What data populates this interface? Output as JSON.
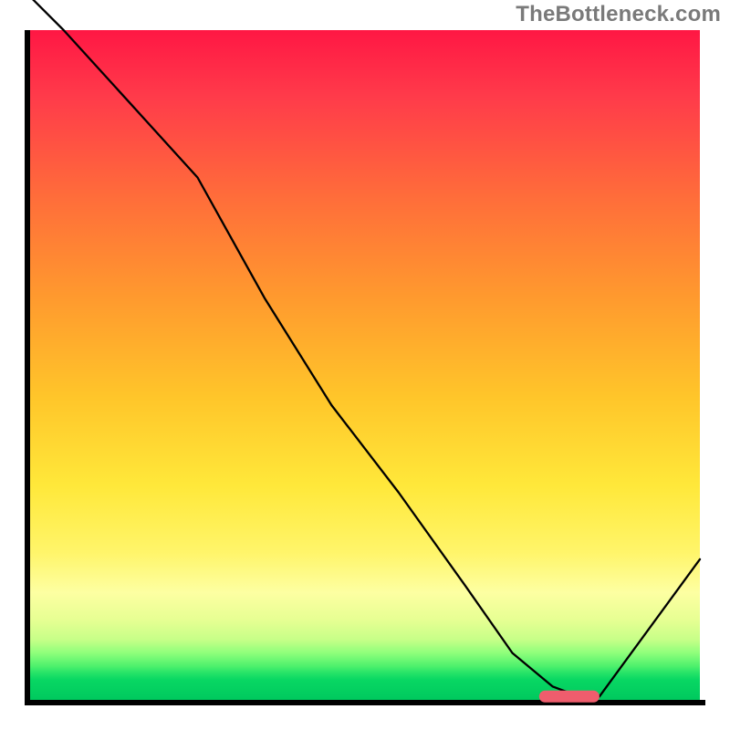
{
  "watermark": "TheBottleneck.com",
  "chart_data": {
    "type": "line",
    "title": "",
    "xlabel": "",
    "ylabel": "",
    "xlim": [
      0,
      100
    ],
    "ylim": [
      0,
      100
    ],
    "grid": false,
    "legend": false,
    "x": [
      0,
      5,
      15,
      25,
      35,
      45,
      55,
      65,
      72,
      78,
      82,
      85,
      100
    ],
    "values": [
      105,
      100,
      89,
      78,
      60,
      44,
      31,
      17,
      7,
      2,
      0.5,
      0.5,
      21
    ],
    "marker": {
      "x_start": 76,
      "x_end": 85,
      "y": 0.5
    },
    "background_gradient": {
      "orientation": "vertical",
      "colors_top_to_bottom": [
        "#ff1744",
        "#ff9a2e",
        "#ffe83a",
        "#fdffa2",
        "#4cf06c",
        "#00c95e"
      ]
    }
  }
}
